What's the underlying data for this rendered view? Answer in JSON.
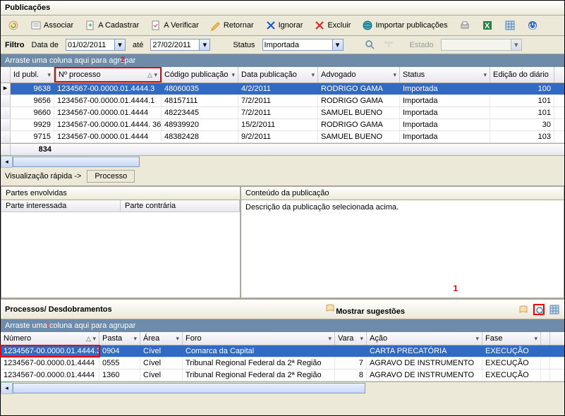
{
  "title": "Publicações",
  "toolbar": {
    "associar": "Associar",
    "cadastrar": "A Cadastrar",
    "verificar": "A Verificar",
    "retornar": "Retornar",
    "ignorar": "Ignorar",
    "excluir": "Excluir",
    "importar": "Importar publicações"
  },
  "filter": {
    "label": "Filtro",
    "data_de_label": "Data de",
    "data_de": "01/02/2011",
    "ate_label": "até",
    "ate": "27/02/2011",
    "status_label": "Status",
    "status": "Importada",
    "estado_label": "Estado"
  },
  "groupbar1": "Arraste uma coluna aqui para agrupar",
  "annot2": "2",
  "grid1": {
    "headers": [
      "Id publ.",
      "Nº processo",
      "Código publicação",
      "Data publicação",
      "Advogado",
      "Status",
      "Edição do diário"
    ],
    "rows": [
      {
        "id": "9638",
        "proc": "1234567-00.0000.01.4444.3",
        "cod": "48060035",
        "data": "4/2/2011",
        "adv": "RODRIGO GAMA",
        "status": "Importada",
        "ed": "100"
      },
      {
        "id": "9656",
        "proc": "1234567-00.0000.01.4444.1",
        "cod": "48157111",
        "data": "7/2/2011",
        "adv": "RODRIGO GAMA",
        "status": "Importada",
        "ed": "101"
      },
      {
        "id": "9660",
        "proc": "1234567-00.0000.01.4444",
        "cod": "48223445",
        "data": "7/2/2011",
        "adv": "SAMUEL BUENO",
        "status": "Importada",
        "ed": "101"
      },
      {
        "id": "9929",
        "proc": "1234567-00.0000.01.4444. 36",
        "cod": "48939920",
        "data": "15/2/2011",
        "adv": "RODRIGO GAMA",
        "status": "Importada",
        "ed": "30"
      },
      {
        "id": "9715",
        "proc": "1234567-00.0000.01.4444",
        "cod": "48382428",
        "data": "9/2/2011",
        "adv": "SAMUEL BUENO",
        "status": "Importada",
        "ed": "103"
      }
    ],
    "count": "834"
  },
  "quickview": {
    "label": "Visualização rápida ->",
    "tab": "Processo"
  },
  "panel_left": {
    "title": "Partes envolvidas",
    "col1": "Parte interessada",
    "col2": "Parte contrária"
  },
  "panel_right": {
    "title": "Conteúdo da publicação",
    "body": "Descrição da publicação selecionada acima."
  },
  "annot1": "1",
  "section2": {
    "title": "Processos/ Desdobramentos",
    "mostrar": "Mostrar sugestões"
  },
  "groupbar2": "Arraste uma coluna aqui para agrupar",
  "grid2": {
    "headers": [
      "Número",
      "Pasta",
      "Área",
      "Foro",
      "Vara",
      "Ação",
      "Fase",
      ""
    ],
    "rows": [
      {
        "num": "1234567-00.0000.01.4444.3",
        "pasta": "0904",
        "area": "Cível",
        "foro": "Comarca da Capital",
        "vara": "",
        "acao": "CARTA PRECATÓRIA",
        "fase": "EXECUÇÃO"
      },
      {
        "num": "1234567-00.0000.01.4444",
        "pasta": "0555",
        "area": "Cível",
        "foro": "Tribunal Regional Federal da 2ª Região",
        "vara": "7",
        "acao": "AGRAVO DE INSTRUMENTO",
        "fase": "EXECUÇÃO"
      },
      {
        "num": "1234567-00.0000.01.4444",
        "pasta": "1360",
        "area": "Cível",
        "foro": "Tribunal Regional Federal da 2ª Região",
        "vara": "8",
        "acao": "AGRAVO DE INSTRUMENTO",
        "fase": "EXECUÇÃO"
      }
    ]
  }
}
